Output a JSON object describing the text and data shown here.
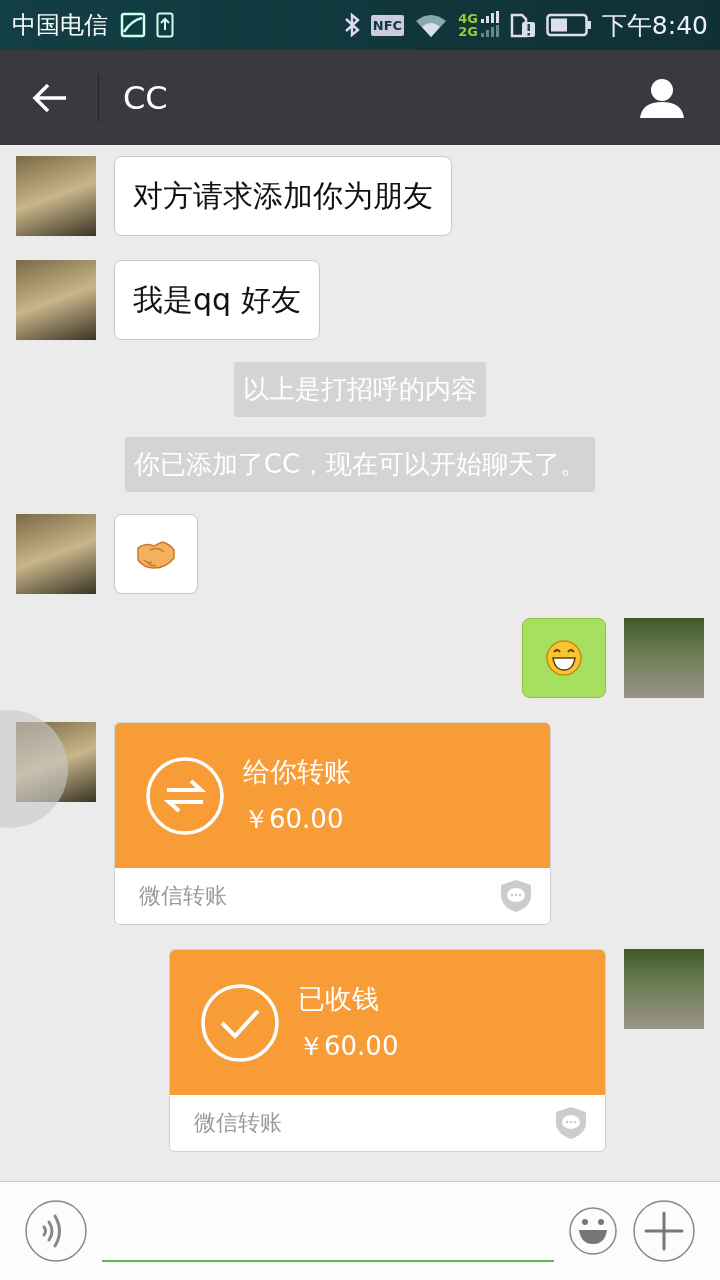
{
  "status_bar": {
    "carrier": "中国电信",
    "nfc": "NFC",
    "net_top": "4G",
    "net_bottom": "2G",
    "time": "下午8:40"
  },
  "header": {
    "title": "CC"
  },
  "messages": [
    {
      "kind": "text",
      "outgoing": false,
      "text": "对方请求添加你为朋友"
    },
    {
      "kind": "text",
      "outgoing": false,
      "text": "我是qq 好友"
    },
    {
      "kind": "system",
      "text": "以上是打招呼的内容"
    },
    {
      "kind": "system",
      "text": "你已添加了CC，现在可以开始聊天了。"
    },
    {
      "kind": "handshake",
      "outgoing": false
    },
    {
      "kind": "grin",
      "outgoing": true
    },
    {
      "kind": "transfer",
      "outgoing": false,
      "received": false,
      "title": "给你转账",
      "amount": "￥60.00",
      "footer": "微信转账"
    },
    {
      "kind": "transfer",
      "outgoing": true,
      "received": true,
      "title": "已收钱",
      "amount": "￥60.00",
      "footer": "微信转账"
    }
  ]
}
